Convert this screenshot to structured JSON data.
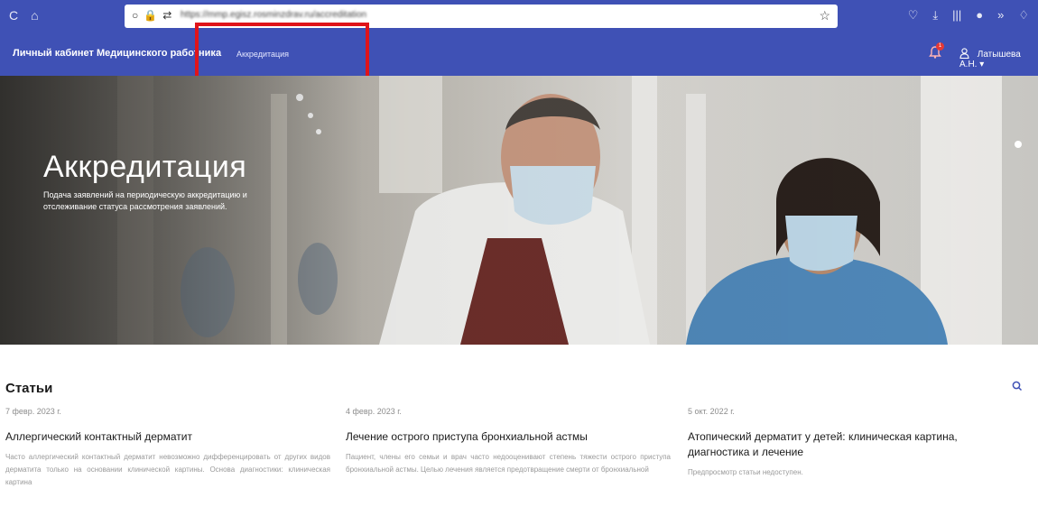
{
  "browser": {
    "nav_icons": [
      "C",
      "⌂"
    ],
    "url_icons": [
      "○",
      "🔒",
      "⇄"
    ],
    "url": "https://mmp.egisz.rosminzdrav.ru/accreditation",
    "star": "☆",
    "right_icons": [
      "♡",
      "⤓",
      "|||",
      "●",
      "»",
      "♢"
    ]
  },
  "app": {
    "brand": "Личный кабинет Медицинского работника",
    "nav_link": "Аккредитация",
    "notification_count": "1",
    "user_name": "Латышева А.Н. ▾"
  },
  "hero": {
    "title": "Аккредитация",
    "subtitle": "Подача заявлений на периодическую аккредитацию и отслеживание статуса рассмотрения заявлений."
  },
  "articles": {
    "section_title": "Статьи",
    "items": [
      {
        "date": "7 февр. 2023 г.",
        "title": "Аллергический контактный дерматит",
        "body": "Часто аллергический контактный дерматит невозможно дифференцировать от других видов дерматита только на основании клинической картины. Основа диагностики: клиническая картина"
      },
      {
        "date": "4 февр. 2023 г.",
        "title": "Лечение острого приступа бронхиальной астмы",
        "body": "Пациент, члены его семьи и врач часто недооценивают степень тяжести острого приступа бронхиальной астмы. Целью лечения является предотвращение смерти от бронхиальной"
      },
      {
        "date": "5 окт. 2022 г.",
        "title": "Атопический дерматит у детей: клиническая картина, диагностика и лечение",
        "body": "Предпросмотр статьи недоступен."
      }
    ]
  },
  "colors": {
    "nav_bg": "#3f51b5",
    "highlight": "#e0141a",
    "accent": "#3f51b5"
  }
}
